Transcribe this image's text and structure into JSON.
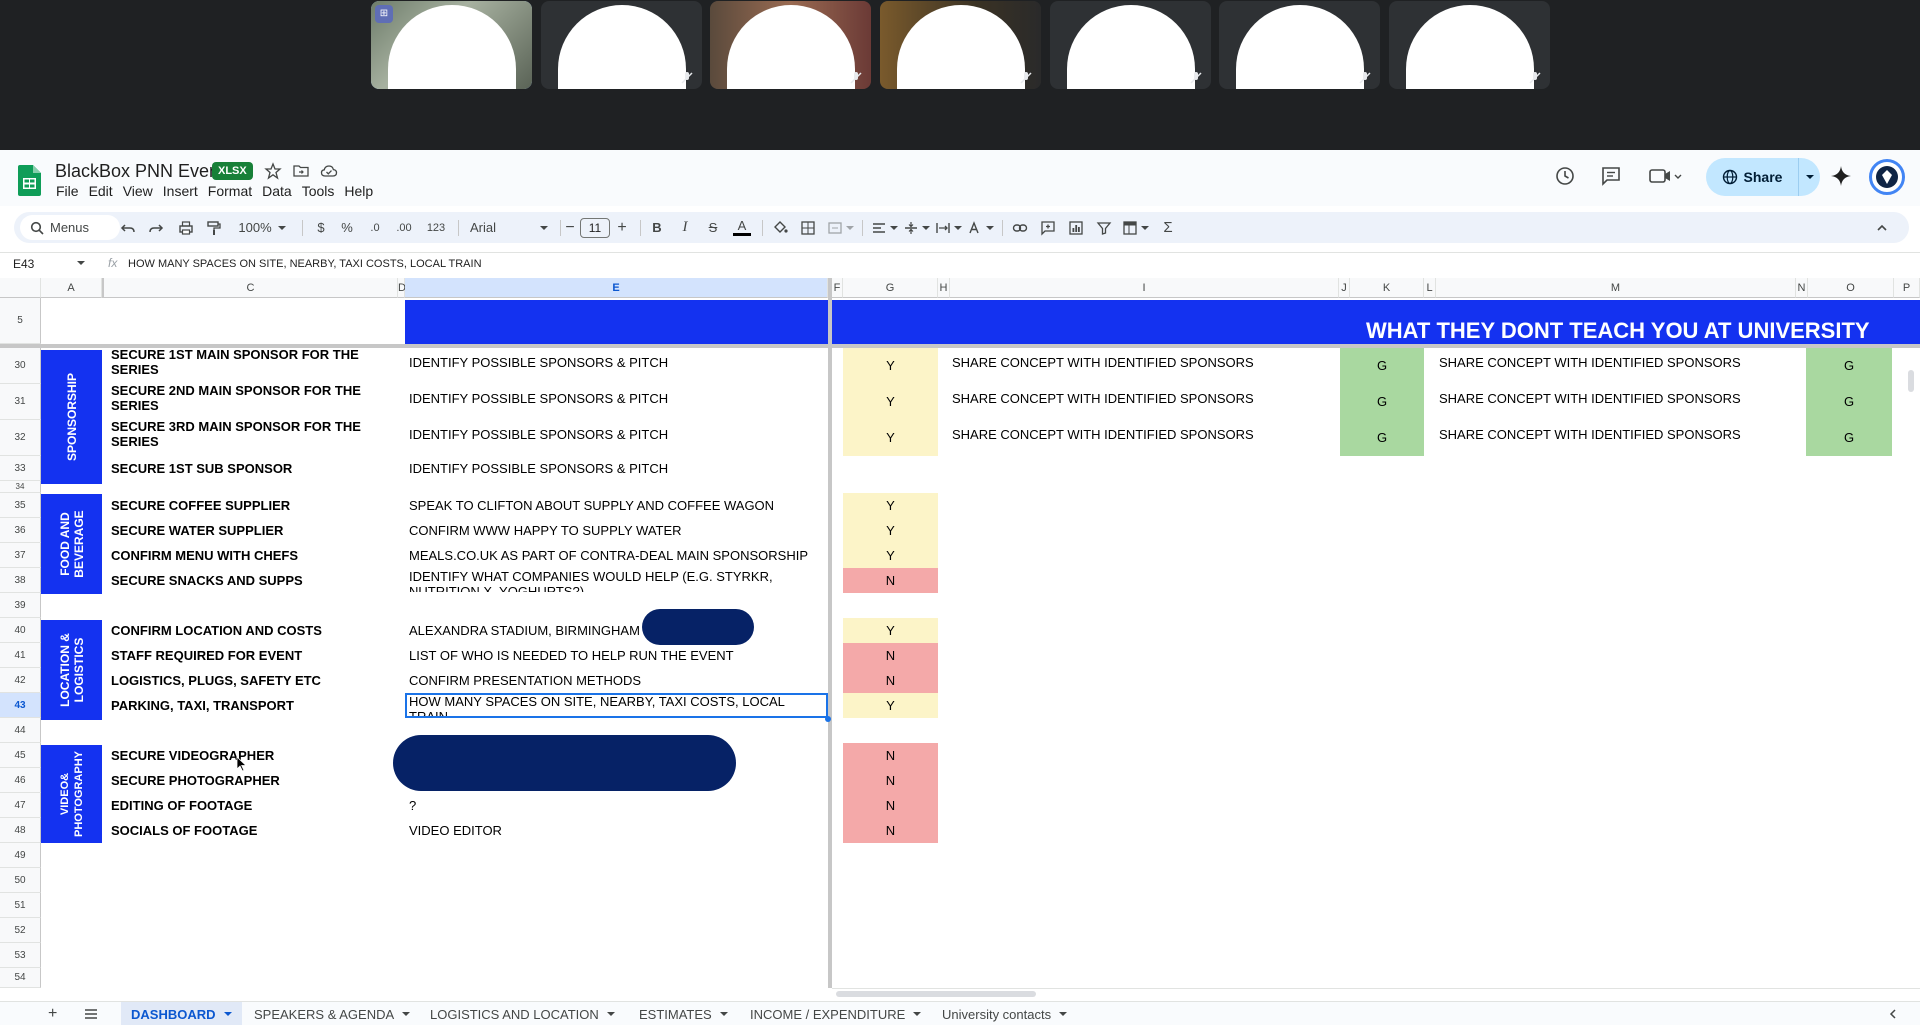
{
  "call": {
    "tile_count": 7
  },
  "app": {
    "title": "BlackBox PNN Event",
    "file_badge": "XLSX",
    "menu": [
      "File",
      "Edit",
      "View",
      "Insert",
      "Format",
      "Data",
      "Tools",
      "Help"
    ],
    "share_label": "Share"
  },
  "toolbar": {
    "search_label": "Menus",
    "zoom": "100%",
    "currency": "$",
    "percent": "%",
    "dec_decrease": ".0",
    "dec_increase": ".00",
    "number_format": "123",
    "font": "Arial",
    "font_size": "11",
    "bold": "B",
    "italic": "I",
    "strike": "S",
    "text_color": "A",
    "sum": "Σ"
  },
  "formula_bar": {
    "cell_ref": "E43",
    "fx": "fx",
    "content": "HOW MANY SPACES ON SITE, NEARBY, TAXI COSTS, LOCAL TRAIN"
  },
  "columns": [
    "A",
    "C",
    "D",
    "E",
    "F",
    "G",
    "H",
    "I",
    "J",
    "K",
    "L",
    "M",
    "N",
    "O",
    "P"
  ],
  "banner": "WHAT THEY DONT TEACH YOU AT UNIVERSITY",
  "rows": {
    "r5": "5",
    "r30": "30",
    "r31": "31",
    "r32": "32",
    "r33": "33",
    "r34": "34",
    "r35": "35",
    "r36": "36",
    "r37": "37",
    "r38": "38",
    "r39": "39",
    "r40": "40",
    "r41": "41",
    "r42": "42",
    "r43": "43",
    "r44": "44",
    "r45": "45",
    "r46": "46",
    "r47": "47",
    "r48": "48",
    "r49": "49",
    "r50": "50",
    "r51": "51",
    "r52": "52",
    "r53": "53",
    "r54": "54"
  },
  "sections": {
    "sponsorship": "SPONSORSHIP",
    "food": "FOOD AND BEVERAGE",
    "location": "LOCATION & LOGISTICS",
    "video": "VIDEO& PHOTOGRAPHY"
  },
  "tasks": [
    {
      "task": "SECURE 1ST MAIN SPONSOR FOR THE SERIES",
      "action": "IDENTIFY POSSIBLE SPONSORS & PITCH",
      "status": "Y",
      "next": "SHARE CONCEPT WITH IDENTIFIED SPONSORS",
      "status2": "G",
      "next2": "SHARE CONCEPT WITH IDENTIFIED SPONSORS",
      "status3": "G"
    },
    {
      "task": "SECURE 2ND MAIN SPONSOR FOR THE SERIES",
      "action": "IDENTIFY POSSIBLE SPONSORS & PITCH",
      "status": "Y",
      "next": "SHARE CONCEPT WITH IDENTIFIED SPONSORS",
      "status2": "G",
      "next2": "SHARE CONCEPT WITH IDENTIFIED SPONSORS",
      "status3": "G"
    },
    {
      "task": "SECURE 3RD MAIN SPONSOR FOR THE SERIES",
      "action": "IDENTIFY POSSIBLE SPONSORS & PITCH",
      "status": "Y",
      "next": "SHARE CONCEPT WITH IDENTIFIED SPONSORS",
      "status2": "G",
      "next2": "SHARE CONCEPT WITH IDENTIFIED SPONSORS",
      "status3": "G"
    },
    {
      "task": "SECURE 1ST SUB SPONSOR",
      "action": "IDENTIFY POSSIBLE SPONSORS & PITCH"
    },
    {
      "task": "SECURE COFFEE SUPPLIER",
      "action": "SPEAK TO CLIFTON ABOUT SUPPLY AND COFFEE WAGON",
      "status": "Y"
    },
    {
      "task": "SECURE WATER SUPPLIER",
      "action": "CONFIRM WWW HAPPY TO SUPPLY WATER",
      "status": "Y"
    },
    {
      "task": "CONFIRM MENU WITH CHEFS",
      "action": "MEALS.CO.UK AS PART OF CONTRA-DEAL MAIN SPONSORSHIP",
      "status": "Y"
    },
    {
      "task": "SECURE SNACKS AND SUPPS",
      "action": "IDENTIFY WHAT COMPANIES WOULD HELP (E.G. STYRKR, NUTRITION X, YOGHURTS?)",
      "status": "N"
    },
    {
      "task": "CONFIRM LOCATION AND COSTS",
      "action": "ALEXANDRA STADIUM, BIRMINGHAM",
      "status": "Y"
    },
    {
      "task": "STAFF REQUIRED FOR EVENT",
      "action": "LIST OF WHO IS NEEDED TO HELP RUN THE EVENT",
      "status": "N"
    },
    {
      "task": "LOGISTICS, PLUGS, SAFETY ETC",
      "action": "CONFIRM PRESENTATION METHODS",
      "status": "N"
    },
    {
      "task": "PARKING, TAXI, TRANSPORT",
      "action": "HOW MANY SPACES ON SITE, NEARBY, TAXI COSTS, LOCAL TRAIN",
      "status": "Y"
    },
    {
      "task": "SECURE VIDEOGRAPHER",
      "status": "N"
    },
    {
      "task": "SECURE PHOTOGRAPHER",
      "status": "N"
    },
    {
      "task": "EDITING OF FOOTAGE",
      "action": "?",
      "status": "N"
    },
    {
      "task": "SOCIALS OF FOOTAGE",
      "action": "VIDEO EDITOR",
      "status": "N"
    }
  ],
  "sheet_tabs": [
    "DASHBOARD",
    "SPEAKERS & AGENDA",
    "LOGISTICS AND LOCATION",
    "ESTIMATES",
    "INCOME / EXPENDITURE",
    "University contacts"
  ],
  "colors": {
    "header_blue": "#1432f0",
    "status_yellow": "#fcf4c8",
    "status_red": "#f4a9a9",
    "status_green": "#a9d8a0"
  }
}
